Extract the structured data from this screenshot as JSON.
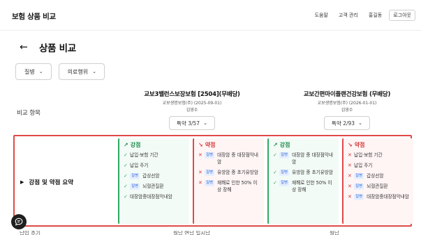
{
  "header": {
    "brand": "보험 상품 비교",
    "nav": {
      "help": "도움말",
      "customers": "고객 관리",
      "user": "홍길동",
      "logout": "로그아웃"
    }
  },
  "page": {
    "title": "상품 비교"
  },
  "filters": [
    {
      "label": "질병"
    },
    {
      "label": "의료행위"
    }
  ],
  "compare": {
    "label": "비교 항목",
    "products": [
      {
        "name": "교보3밸런스보장보험 [2504](무배당)",
        "company": "교보생명보험(주) (2025-09-01)",
        "person": "김영수",
        "special": "특약 3/57"
      },
      {
        "name": "교보간편마이플랜건강보험 (무배당)",
        "company": "교보생명보험(주) (2026-01-01)",
        "person": "김영수",
        "special": "특약 2/93"
      }
    ]
  },
  "summary": {
    "label": "강점 및 약점 요약",
    "cards": [
      {
        "type": "good",
        "title": "강점",
        "items": [
          {
            "tag": "",
            "text": "납입·보험 기간"
          },
          {
            "tag": "",
            "text": "납입 주기"
          },
          {
            "tag": "질병",
            "text": "갑상선암"
          },
          {
            "tag": "질병",
            "text": "뇌혈관질환"
          },
          {
            "tag": "",
            "text": "대장암중대장점막내암"
          }
        ]
      },
      {
        "type": "bad",
        "title": "약점",
        "items": [
          {
            "tag": "질병",
            "text": "대장암 중 대장점막내암"
          },
          {
            "tag": "질병",
            "text": "유방암 중 초기유방암"
          },
          {
            "tag": "질병",
            "text": "재해로 인한 50% 이상 장해"
          }
        ]
      },
      {
        "type": "good",
        "title": "강점",
        "items": [
          {
            "tag": "질병",
            "text": "대장암 중 대장점막내암"
          },
          {
            "tag": "질병",
            "text": "유방암 중 초기유방암"
          },
          {
            "tag": "질병",
            "text": "재해로 인한 50% 이상 장해"
          }
        ]
      },
      {
        "type": "bad",
        "title": "약점",
        "items": [
          {
            "tag": "",
            "text": "납입·보험 기간"
          },
          {
            "tag": "",
            "text": "납입 주기"
          },
          {
            "tag": "질병",
            "text": "갑상선암"
          },
          {
            "tag": "질병",
            "text": "뇌혈관질환"
          },
          {
            "tag": "질병",
            "text": "대장암중대장점막내암"
          }
        ]
      }
    ]
  },
  "bottom_row": {
    "label": "납입 주기",
    "value1": "월납 연납 일시납",
    "value2": "월납"
  },
  "colors": {
    "strength": "#2eaa62",
    "weakness": "#e04848",
    "tag_bg": "#e6efff",
    "tag_text": "#3a6fd8"
  }
}
